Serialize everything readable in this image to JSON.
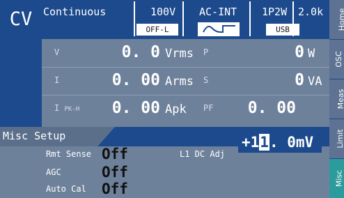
{
  "header": {
    "mode": "CV",
    "run_mode": "Continuous",
    "range": "100V",
    "source": "AC-INT",
    "phase": "1P2W",
    "freq_range": "2.0k",
    "limit_tag": "OFF-L",
    "io_tag": "USB"
  },
  "meter": {
    "v": {
      "label": "V",
      "value": "0. 0",
      "unit": "Vrms"
    },
    "i": {
      "label": "I",
      "value": "0. 00",
      "unit": "Arms"
    },
    "ipk": {
      "label": "I",
      "sub": "PK-H",
      "value": "0. 00",
      "unit": "Apk"
    },
    "p": {
      "label": "P",
      "value": "0",
      "unit": "W"
    },
    "s": {
      "label": "S",
      "value": "0",
      "unit": "VA"
    },
    "pf": {
      "label": "PF",
      "value": "0. 00",
      "unit": ""
    }
  },
  "misc": {
    "title": "Misc Setup",
    "rmt_sense": {
      "label": "Rmt Sense",
      "value": "Off"
    },
    "agc": {
      "label": "AGC",
      "value": "Off"
    },
    "auto_cal": {
      "label": "Auto Cal",
      "value": "Off"
    },
    "dc_adj": {
      "label": "L1 DC Adj",
      "prefix": "+1",
      "cursor": "1",
      "suffix": ". 0mV"
    }
  },
  "tabs": [
    {
      "label": "Home",
      "active": false
    },
    {
      "label": "OSC",
      "active": false
    },
    {
      "label": "Meas",
      "active": false
    },
    {
      "label": "Limit",
      "active": false
    },
    {
      "label": "Misc",
      "active": true
    }
  ]
}
